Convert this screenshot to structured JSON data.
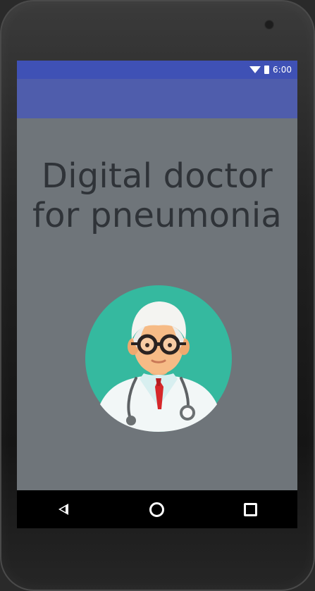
{
  "status_bar": {
    "time": "6:00",
    "icons": [
      "wifi-icon",
      "battery-icon"
    ],
    "bg_color": "#3f51b5"
  },
  "toolbar": {
    "bg_color": "#4f5dac"
  },
  "main": {
    "title_line1": "Digital doctor",
    "title_line2": "for pneumonia",
    "avatar_icon": "doctor-icon",
    "bg_color": "#6f757a",
    "avatar_circle_color": "#35b99f"
  },
  "nav_bar": {
    "buttons": [
      "back-icon",
      "home-icon",
      "recent-apps-icon"
    ]
  }
}
